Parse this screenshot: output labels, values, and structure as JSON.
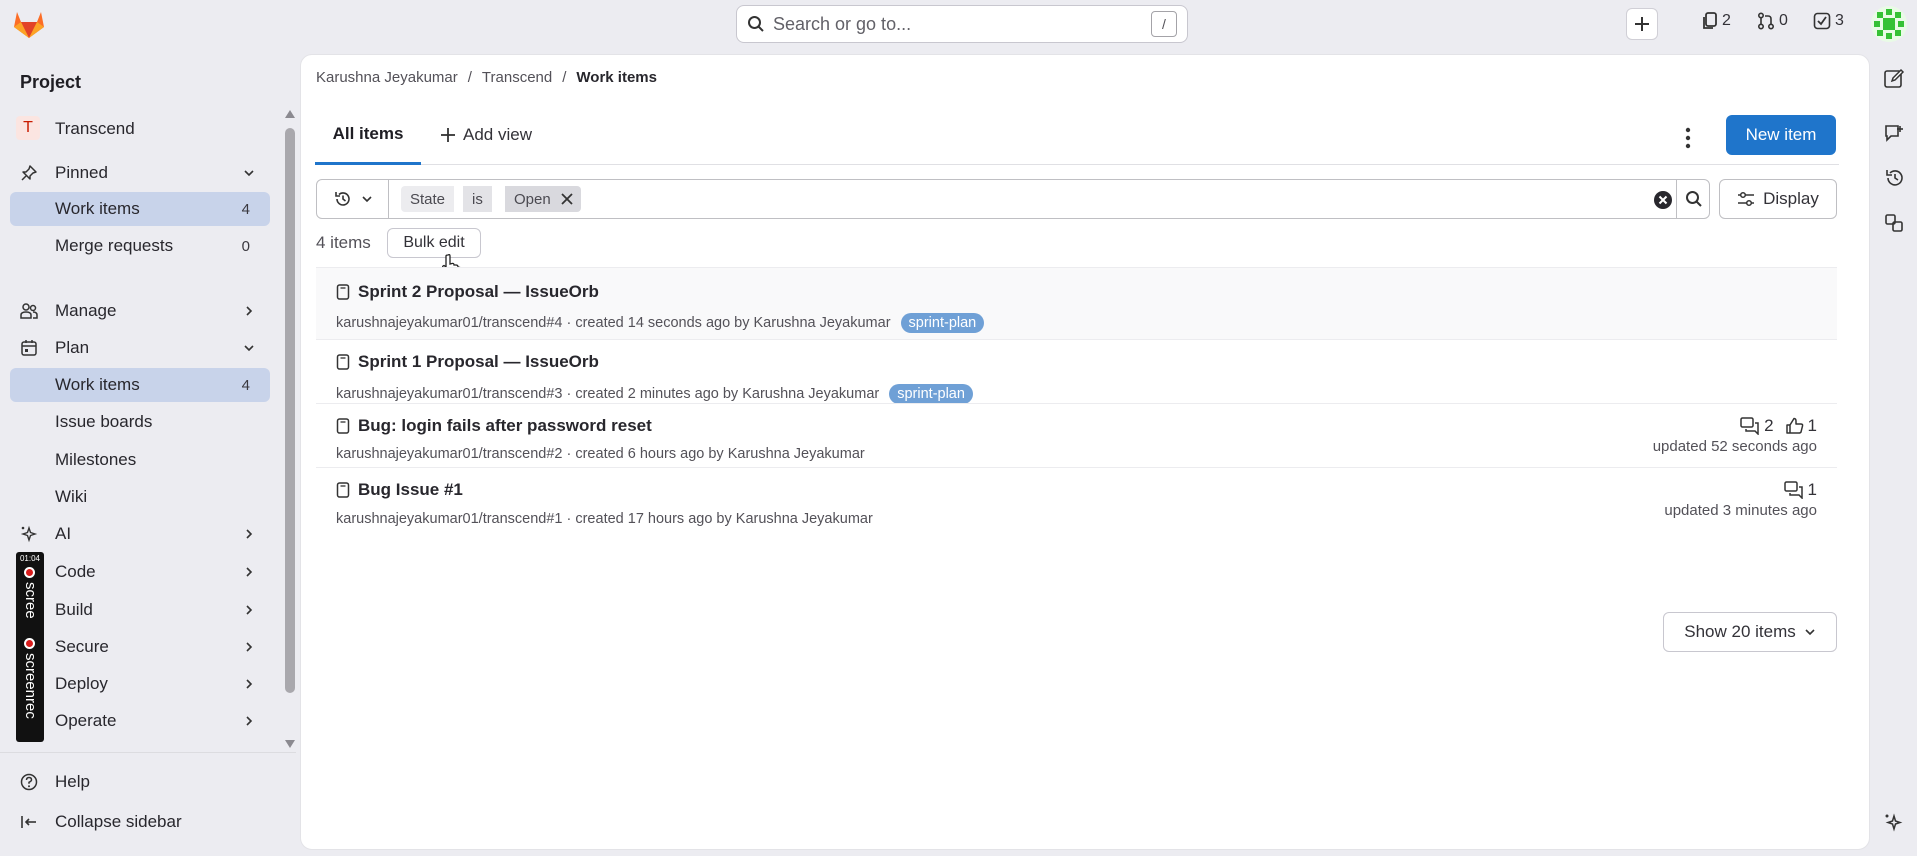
{
  "topbar": {
    "search_placeholder": "Search or go to...",
    "search_shortcut": "/",
    "issues_count": "2",
    "mr_count": "0",
    "todo_count": "3"
  },
  "sidebar": {
    "section_title": "Project",
    "project_initial": "T",
    "project_name": "Transcend",
    "pinned": {
      "label": "Pinned",
      "items": [
        {
          "label": "Work items",
          "count": "4"
        },
        {
          "label": "Merge requests",
          "count": "0"
        }
      ]
    },
    "manage_label": "Manage",
    "plan": {
      "label": "Plan",
      "items": [
        {
          "label": "Work items",
          "count": "4"
        },
        {
          "label": "Issue boards"
        },
        {
          "label": "Milestones"
        },
        {
          "label": "Wiki"
        }
      ]
    },
    "sections": [
      "AI",
      "Code",
      "Build",
      "Secure",
      "Deploy",
      "Operate"
    ],
    "help_label": "Help",
    "collapse_label": "Collapse sidebar"
  },
  "recorder": {
    "time": "01:04",
    "text1": "scree",
    "text2": "screenrec"
  },
  "breadcrumb": {
    "user": "Karushna Jeyakumar",
    "project": "Transcend",
    "current": "Work items",
    "sep": "/"
  },
  "tabs": {
    "all_items": "All items",
    "add_view": "Add view"
  },
  "new_item_label": "New item",
  "filter": {
    "token_field": "State",
    "token_op": "is",
    "token_value": "Open"
  },
  "display_label": "Display",
  "count_text": "4 items",
  "bulk_edit_label": "Bulk edit",
  "items": [
    {
      "title": "Sprint 2 Proposal — IssueOrb",
      "ref": "karushnajeyakumar01/transcend#4",
      "meta": "· created 14 seconds ago by Karushna Jeyakumar",
      "label": "sprint-plan"
    },
    {
      "title": "Sprint 1 Proposal — IssueOrb",
      "ref": "karushnajeyakumar01/transcend#3",
      "meta": "· created 2 minutes ago by Karushna Jeyakumar",
      "label": "sprint-plan"
    },
    {
      "title": "Bug: login fails after password reset",
      "ref": "karushnajeyakumar01/transcend#2",
      "meta": "· created 6 hours ago by Karushna Jeyakumar",
      "comments": "2",
      "upvotes": "1",
      "updated": "updated 52 seconds ago"
    },
    {
      "title": "Bug Issue #1",
      "ref": "karushnajeyakumar01/transcend#1",
      "meta": "· created 17 hours ago by Karushna Jeyakumar",
      "comments": "1",
      "updated": "updated 3 minutes ago"
    }
  ],
  "show_items_label": "Show 20 items",
  "colors": {
    "accent": "#1f75cb",
    "active_nav": "#c8d3ea",
    "label_pill": "#6fa0d6"
  }
}
